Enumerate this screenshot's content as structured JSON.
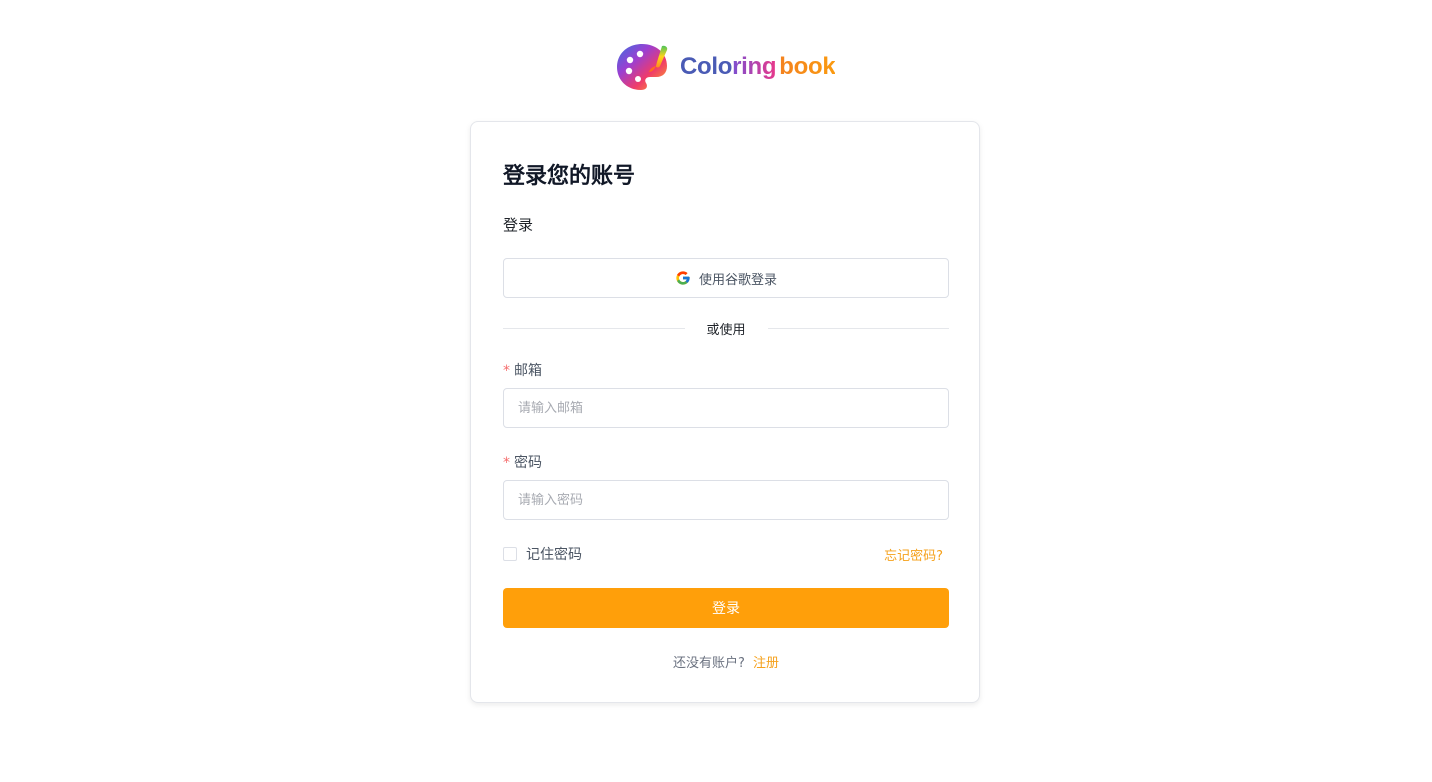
{
  "brand": {
    "name_part1": "Colo",
    "name_part2": "ring",
    "name_part3": "book",
    "logo_icon": "palette-icon"
  },
  "login_card": {
    "title": "登录您的账号",
    "subtitle": "登录",
    "google_button_label": "使用谷歌登录",
    "google_icon": "google-icon",
    "divider_text": "或使用",
    "email": {
      "required_mark": "*",
      "label": "邮箱",
      "placeholder": "请输入邮箱",
      "value": ""
    },
    "password": {
      "required_mark": "*",
      "label": "密码",
      "placeholder": "请输入密码",
      "value": ""
    },
    "remember_label": "记住密码",
    "remember_checked": false,
    "forgot_link": "忘记密码?",
    "login_button_label": "登录",
    "signup_question": "还没有账户?",
    "signup_link": "注册"
  },
  "colors": {
    "accent": "#ff9f0a",
    "link": "#f5a11c",
    "required": "#f56c6c",
    "border": "#dcdfe6"
  }
}
